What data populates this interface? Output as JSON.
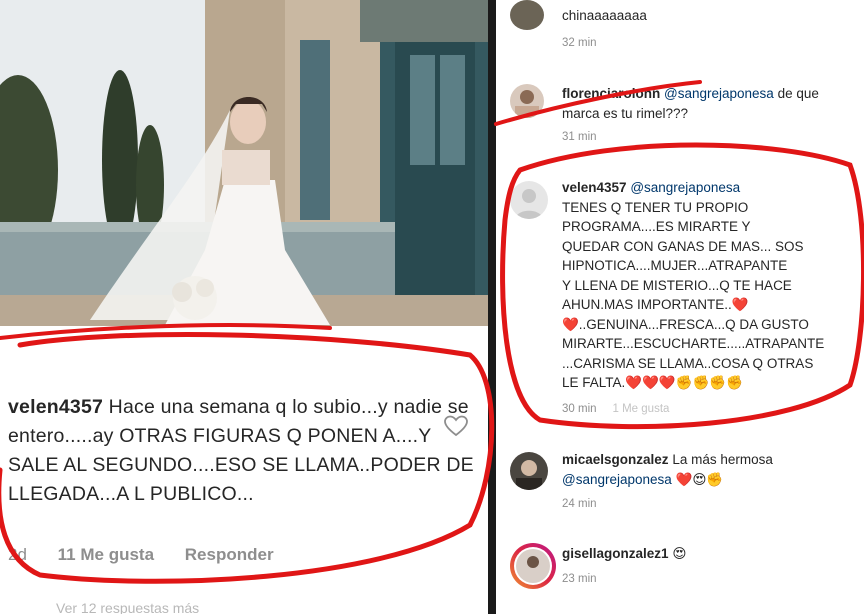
{
  "left_post": {
    "photo_alt": "bride-photo",
    "comment": {
      "username": "velen4357",
      "text": "Hace una semana q lo subio...y nadie se entero.....ay OTRAS FIGURAS Q PONEN  A....Y  SALE AL SEGUNDO....ESO SE LLAMA..PODER DE LLEGADA...A L PUBLICO..."
    },
    "meta": {
      "time": "2d",
      "likes": "11 Me gusta",
      "reply": "Responder"
    },
    "faded_text": "Ver 12 respuestas más"
  },
  "right_comments": [
    {
      "username": "",
      "text": "chinaaaaaaaa",
      "time": "32 min"
    },
    {
      "username": "florenciarolonn",
      "mention": "@sangrejaponesa",
      "text": "de que marca es tu rimel???",
      "time": "31 min"
    },
    {
      "username": "velen4357",
      "mention": "@sangrejaponesa",
      "lines": [
        "TENES Q TENER TU PROPIO",
        "PROGRAMA....ES MIRARTE Y",
        "QUEDAR CON GANAS DE MAS... SOS",
        "HIPNOTICA....MUJER...ATRAPANTE",
        "Y LLENA DE MISTERIO...Q TE HACE",
        "AHUN.MAS IMPORTANTE..❤️",
        "❤️..GENUINA...FRESCA...Q DA GUSTO",
        "MIRARTE...ESCUCHARTE.....ATRAPANTE",
        "...CARISMA SE LLAMA..COSA Q OTRAS",
        "LE FALTA.❤️❤️❤️✊✊✊✊"
      ],
      "time": "30 min",
      "extra": "1 Me gusta"
    },
    {
      "username": "micaelsgonzalez",
      "text": "La más hermosa",
      "mention": "@sangrejaponesa",
      "emoji": "❤️😍✊",
      "time": "24 min"
    },
    {
      "username": "gisellagonzalez1",
      "emoji": "😍",
      "time": "23 min"
    }
  ],
  "colors": {
    "marker": "#e01616",
    "text": "#262626",
    "meta": "#8e8e8e",
    "mention": "#00376b"
  },
  "icons": [
    "heart-outline-icon",
    "default-avatar-icon"
  ]
}
